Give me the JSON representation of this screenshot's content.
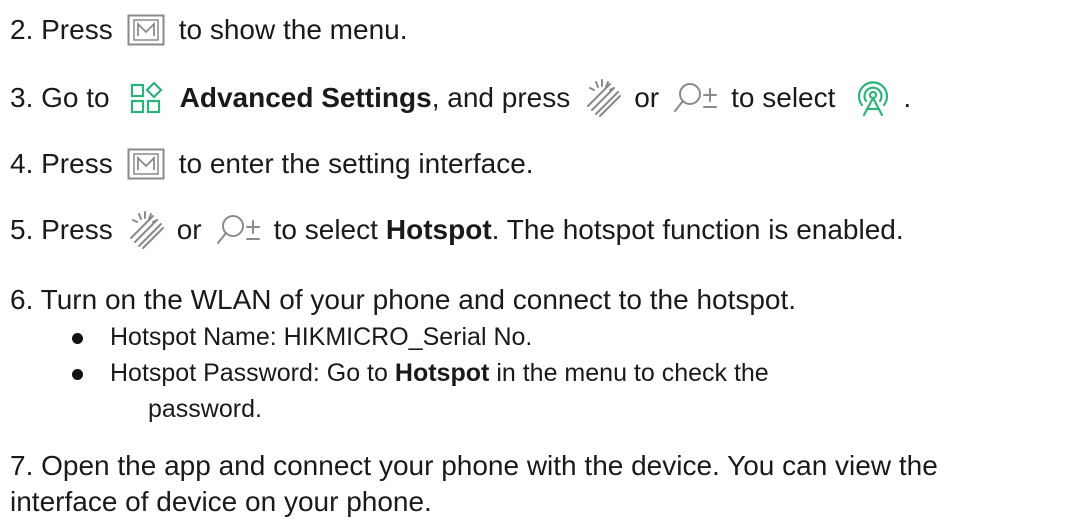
{
  "steps": {
    "s2": {
      "num": "2. Press",
      "rest": "to show the menu."
    },
    "s3": {
      "num": "3. Go to",
      "bold": "Advanced Settings",
      "mid": ", and press",
      "or": "or",
      "rest": "to select",
      "end": "."
    },
    "s4": {
      "num": "4. Press",
      "rest": "to enter the setting interface."
    },
    "s5": {
      "num": "5. Press",
      "or": "or",
      "pre": "to select",
      "bold": "Hotspot",
      "rest": ". The hotspot function is enabled."
    },
    "s6": {
      "text": "6. Turn on the WLAN of your phone and connect to the hotspot.",
      "bullets": [
        {
          "text": "Hotspot Name: HIKMICRO_Serial No."
        },
        {
          "pre": "Hotspot Password: Go to",
          "bold": "Hotspot",
          "rest": "in the menu to check the",
          "cont": "password."
        }
      ]
    },
    "s7": {
      "line1": "7. Open the app and connect your phone with the device. You can view the",
      "line2": "interface of device on your phone."
    }
  },
  "icons": {
    "menu_key": "m-button-icon",
    "advanced_settings": "advanced-settings-icon",
    "brightness": "brightness-icon",
    "zoom": "zoom-icon",
    "hotspot": "hotspot-icon"
  },
  "colors": {
    "accent": "#2db37a",
    "text": "#1a1a1a",
    "icon_gray": "#8a8a8a"
  }
}
